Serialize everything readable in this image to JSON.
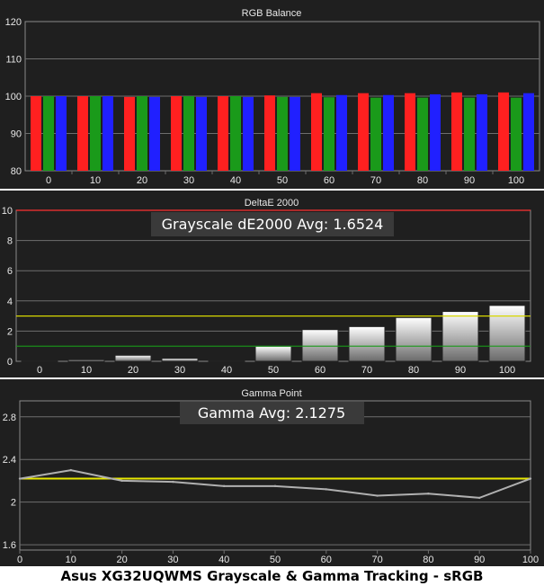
{
  "chart_data": [
    {
      "type": "bar",
      "title": "RGB Balance",
      "categories": [
        "0",
        "10",
        "20",
        "30",
        "40",
        "50",
        "60",
        "70",
        "80",
        "90",
        "100"
      ],
      "ylim": [
        80,
        120
      ],
      "yticks": [
        80,
        90,
        100,
        110,
        120
      ],
      "grid": true,
      "series": [
        {
          "color": "#ff2020",
          "values": [
            100.0,
            100.0,
            99.8,
            100.0,
            100.0,
            100.2,
            100.8,
            100.8,
            100.8,
            101.0,
            101.0
          ]
        },
        {
          "color": "#1a9a1a",
          "values": [
            100.0,
            100.0,
            100.0,
            100.0,
            100.0,
            99.8,
            99.7,
            99.6,
            99.6,
            99.6,
            99.6
          ]
        },
        {
          "color": "#2020ff",
          "values": [
            100.0,
            100.0,
            99.8,
            99.8,
            99.8,
            99.8,
            100.3,
            100.3,
            100.5,
            100.5,
            100.8
          ]
        }
      ]
    },
    {
      "type": "bar",
      "title": "DeltaE 2000",
      "categories": [
        "0",
        "10",
        "20",
        "30",
        "40",
        "50",
        "60",
        "70",
        "80",
        "90",
        "100"
      ],
      "values": [
        0.05,
        0.1,
        0.4,
        0.2,
        0.05,
        1.0,
        2.1,
        2.3,
        2.9,
        3.3,
        3.7
      ],
      "ylim": [
        0,
        10
      ],
      "yticks": [
        0,
        2,
        4,
        6,
        8,
        10
      ],
      "grid": true,
      "reference_lines": [
        {
          "value": 10,
          "color": "#ff3030"
        },
        {
          "value": 3,
          "color": "#d8d800"
        },
        {
          "value": 1,
          "color": "#1a9a1a"
        }
      ],
      "annotation": "Grayscale dE2000 Avg: 1.6524"
    },
    {
      "type": "line",
      "title": "Gamma Point",
      "x": [
        0,
        10,
        20,
        30,
        40,
        50,
        60,
        70,
        80,
        90,
        100
      ],
      "values": [
        2.22,
        2.3,
        2.2,
        2.19,
        2.15,
        2.15,
        2.12,
        2.06,
        2.08,
        2.04,
        2.22
      ],
      "xlim": [
        0,
        100
      ],
      "ylim": [
        1.55,
        2.95
      ],
      "yticks": [
        "1.6",
        "2",
        "2.4",
        "2.8"
      ],
      "xticks": [
        "0",
        "10",
        "20",
        "30",
        "40",
        "50",
        "60",
        "70",
        "80",
        "90",
        "100"
      ],
      "grid": true,
      "line_color": "#b0b0b0",
      "reference_lines": [
        {
          "value": 2.22,
          "color": "#e8e800"
        }
      ],
      "annotation": "Gamma Avg: 2.1275"
    }
  ],
  "footer": {
    "title": "Asus XG32UQWMS Grayscale & Gamma Tracking - sRGB"
  }
}
